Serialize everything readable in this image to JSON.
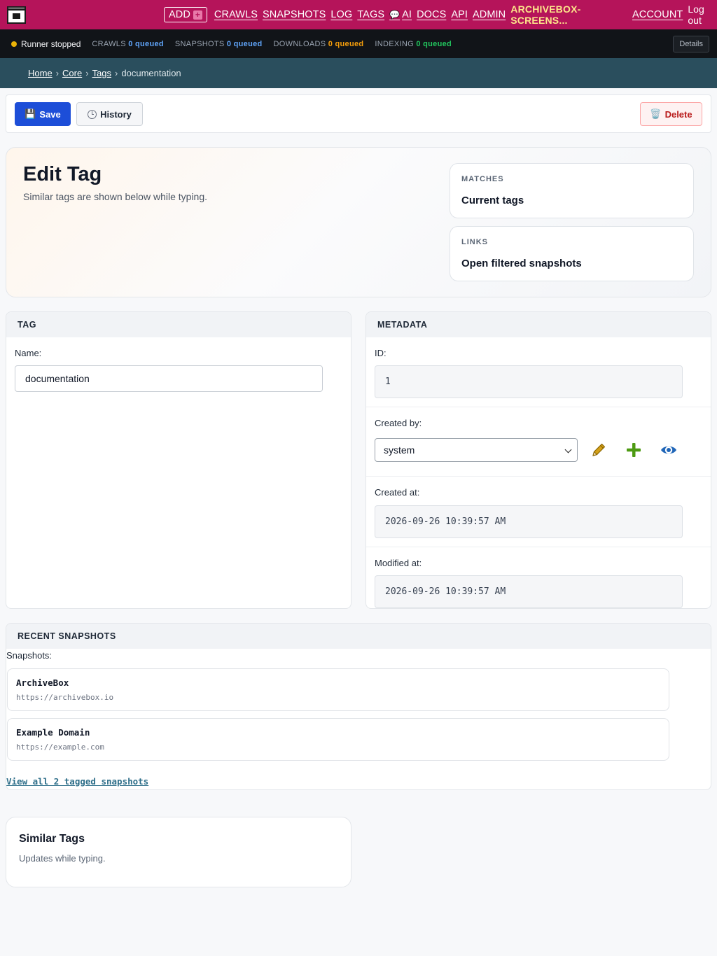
{
  "nav": {
    "add_label": "ADD",
    "links": [
      "CRAWLS",
      "SNAPSHOTS",
      "LOG",
      "TAGS"
    ],
    "ai_label": "AI",
    "links2": [
      "DOCS",
      "API",
      "ADMIN"
    ],
    "brand": "ARCHIVEBOX-SCREENS...",
    "account": "ACCOUNT",
    "logout": "Log out"
  },
  "status": {
    "runner": "Runner stopped",
    "crawls_label": "CRAWLS",
    "crawls_value": "0 queued",
    "snapshots_label": "SNAPSHOTS",
    "snapshots_value": "0 queued",
    "downloads_label": "DOWNLOADS",
    "downloads_value": "0 queued",
    "indexing_label": "INDEXING",
    "indexing_value": "0 queued",
    "details": "Details"
  },
  "breadcrumb": {
    "home": "Home",
    "core": "Core",
    "tags": "Tags",
    "current": "documentation",
    "separator": "›"
  },
  "actions": {
    "save": "Save",
    "history": "History",
    "delete": "Delete",
    "save_glyph": "💾",
    "delete_glyph": "🗑️"
  },
  "hero": {
    "title": "Edit Tag",
    "subtitle": "Similar tags are shown below while typing.",
    "cards": [
      {
        "label": "MATCHES",
        "value": "Current tags"
      },
      {
        "label": "LINKS",
        "value": "Open filtered snapshots"
      }
    ]
  },
  "tag_panel": {
    "header": "TAG",
    "name_label": "Name:",
    "name_value": "documentation"
  },
  "meta_panel": {
    "header": "METADATA",
    "id_label": "ID:",
    "id_value": "1",
    "created_by_label": "Created by:",
    "created_by_value": "system",
    "created_at_label": "Created at:",
    "created_at_value": "2026-09-26 10:39:57 AM",
    "modified_at_label": "Modified at:",
    "modified_at_value": "2026-09-26 10:39:57 AM"
  },
  "snapshots_panel": {
    "header": "RECENT SNAPSHOTS",
    "label": "Snapshots:",
    "items": [
      {
        "title": "ArchiveBox",
        "url": "https://archivebox.io"
      },
      {
        "title": "Example Domain",
        "url": "https://example.com"
      }
    ],
    "view_all": "View all 2 tagged snapshots"
  },
  "similar": {
    "title": "Similar Tags",
    "subtitle": "Updates while typing."
  },
  "colors": {
    "nav_bg": "#b5145a",
    "status_bg": "#111418",
    "breadcrumb_bg": "#2a4e5d",
    "primary": "#1d4ed8",
    "danger": "#b91c1c",
    "brand_text": "#fde68a"
  },
  "icons": {
    "logo": "archivebox-logo-icon",
    "pencil": "pencil-icon",
    "plus": "plus-icon",
    "eye": "eye-icon",
    "clock": "clock-icon"
  }
}
